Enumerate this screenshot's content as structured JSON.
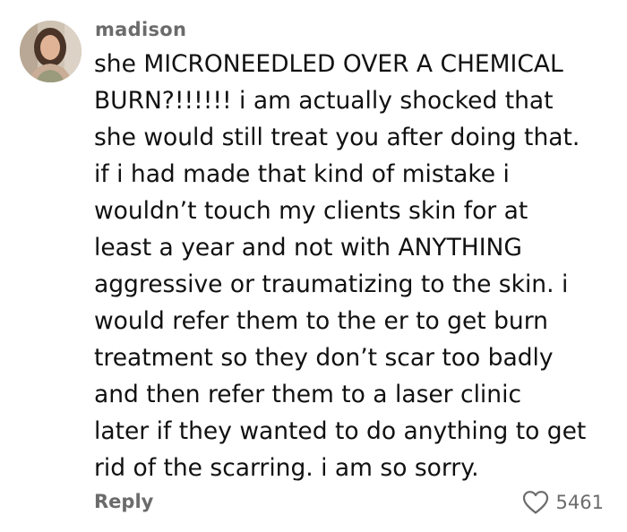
{
  "comment": {
    "username": "madison",
    "avatar_icon": "user-avatar-photo",
    "lines": [
      "she MICRONEEDLED OVER A CHEMICAL",
      "BURN?!!!!!! i am actually shocked that",
      "she would still treat you after doing that.",
      "if i had made that kind of mistake i",
      "wouldn’t touch my clients skin for at",
      "least a year and not with ANYTHING",
      "aggressive or traumatizing to the skin. i",
      "would refer them to the er to get burn",
      "treatment so they don’t scar too badly",
      "and then refer them to a laser clinic",
      "later if they wanted to do anything to get",
      "rid of the scarring. i am so sorry."
    ],
    "reply_label": "Reply",
    "like_icon": "heart-outline-icon",
    "like_count": "5461"
  },
  "colors": {
    "text_primary": "#111111",
    "text_muted": "#6b6b6b",
    "background": "#ffffff"
  }
}
